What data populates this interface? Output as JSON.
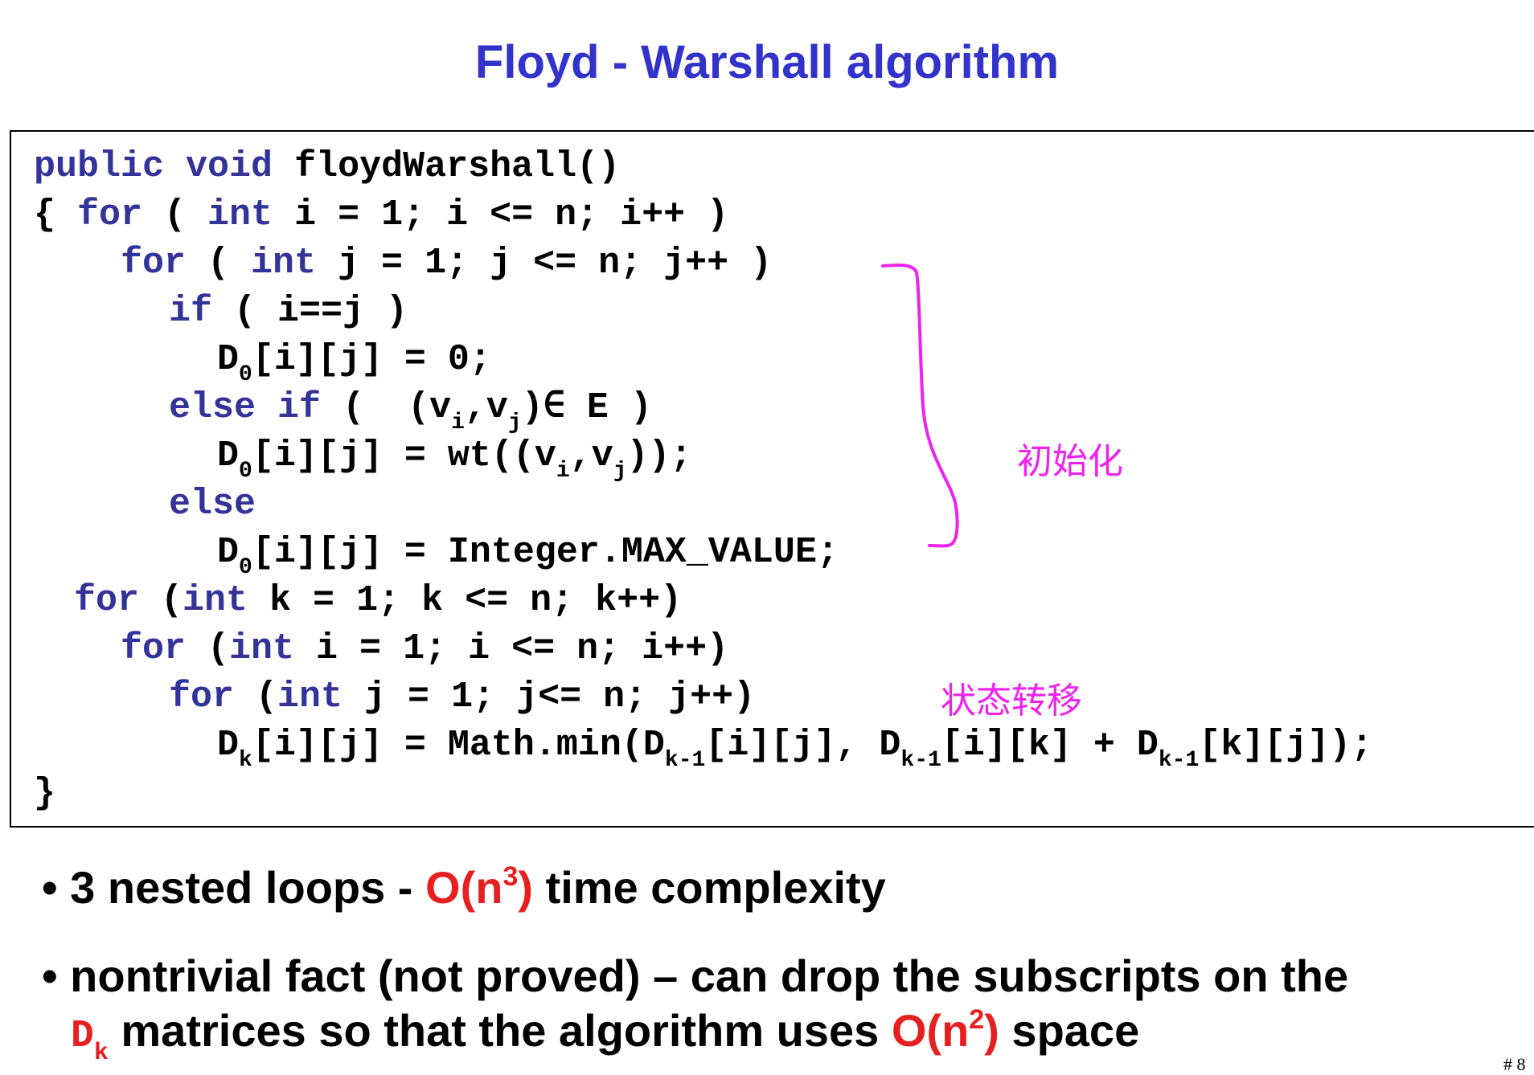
{
  "title": "Floyd - Warshall algorithm",
  "code": {
    "l1_kw1": "public",
    "l1_kw2": "void",
    "l1_rest": " floydWarshall()",
    "l2_a": "{ ",
    "l2_for": "for",
    "l2_b": " ( ",
    "l2_int": "int",
    "l2_c": " i = 1; i <= n; i++ )",
    "l3_for": "for",
    "l3_b": " ( ",
    "l3_int": "int",
    "l3_c": " j = 1; j <= n; j++ )",
    "l4_if": "if",
    "l4_b": " ( i==j )",
    "l5_D": "D",
    "l5_sub": "0",
    "l5_rest": "[i][j] = 0;",
    "l6_else": "else",
    "l6_if": "if",
    "l6_b": " (  (v",
    "l6_si": "i",
    "l6_c": ",v",
    "l6_sj": "j",
    "l6_d": ")∈ E )",
    "l7_D": "D",
    "l7_sub": "0",
    "l7_b": "[i][j] = wt((v",
    "l7_si": "i",
    "l7_c": ",v",
    "l7_sj": "j",
    "l7_d": "));",
    "l8_else": "else",
    "l9_D": "D",
    "l9_sub": "0",
    "l9_rest": "[i][j] = Integer.MAX_VALUE;",
    "l10_for": "for",
    "l10_b": " (",
    "l10_int": "int",
    "l10_c": " k = 1; k <= n; k++)",
    "l11_for": "for",
    "l11_b": " (",
    "l11_int": "int",
    "l11_c": " i = 1; i <= n; i++)",
    "l12_for": "for",
    "l12_b": " (",
    "l12_int": "int",
    "l12_c": " j = 1; j<= n; j++)",
    "l13_D": "D",
    "l13_sub": "k",
    "l13_b": "[i][j] = Math.min(D",
    "l13_s2": "k-1",
    "l13_c": "[i][j], D",
    "l13_s3": "k-1",
    "l13_d": "[i][k] + D",
    "l13_s4": "k-1",
    "l13_e": "[k][j]);",
    "l14": "}"
  },
  "annotations": {
    "init": "初始化",
    "transition": "状态转移",
    "color": "#ee22ee"
  },
  "bullets": {
    "b1_text": "• 3 nested loops  -  ",
    "b1_red": "O(n",
    "b1_sup": "3",
    "b1_red2": ")",
    "b1_tail": " time complexity",
    "b2_line1": "• nontrivial fact (not proved) – can drop the subscripts on the",
    "b2_D": "D",
    "b2_Dsub": "k",
    "b2_mid": " matrices so that the algorithm uses ",
    "b2_red": "O(n",
    "b2_sup": "2",
    "b2_red2": ")",
    "b2_tail": " space"
  },
  "page_number": "# 8",
  "colors": {
    "title": "#3333cc",
    "keyword": "#333399",
    "highlight_red": "#e62020"
  }
}
